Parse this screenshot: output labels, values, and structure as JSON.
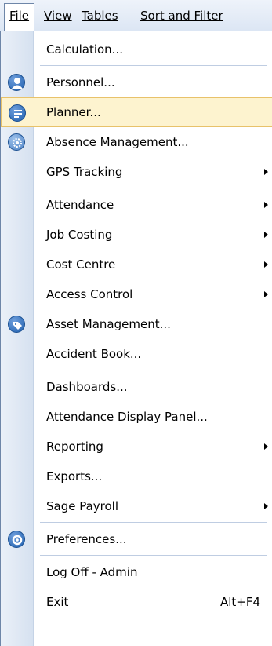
{
  "menubar": {
    "file": "File",
    "view": "View",
    "tables": "Tables",
    "sort_filter": "Sort and Filter"
  },
  "menu": {
    "calculation": "Calculation...",
    "personnel": "Personnel...",
    "planner": "Planner...",
    "absence": "Absence Management...",
    "gps": "GPS Tracking",
    "attendance": "Attendance",
    "job_costing": "Job Costing",
    "cost_centre": "Cost Centre",
    "access_control": "Access Control",
    "asset": "Asset Management...",
    "accident": "Accident Book...",
    "dashboards": "Dashboards...",
    "attendance_panel": "Attendance Display Panel...",
    "reporting": "Reporting",
    "exports": "Exports...",
    "sage": "Sage Payroll",
    "preferences": "Preferences...",
    "logoff": "Log Off - Admin",
    "exit": "Exit",
    "exit_shortcut": "Alt+F4"
  },
  "colors": {
    "highlight_bg": "#fdf3cf",
    "highlight_border": "#e8c26a",
    "icon_blue": "#1f5fae"
  },
  "icons": {
    "personnel": "person-icon",
    "planner": "planner-icon",
    "absence": "gear-icon",
    "asset": "tag-icon",
    "preferences": "settings-icon"
  }
}
